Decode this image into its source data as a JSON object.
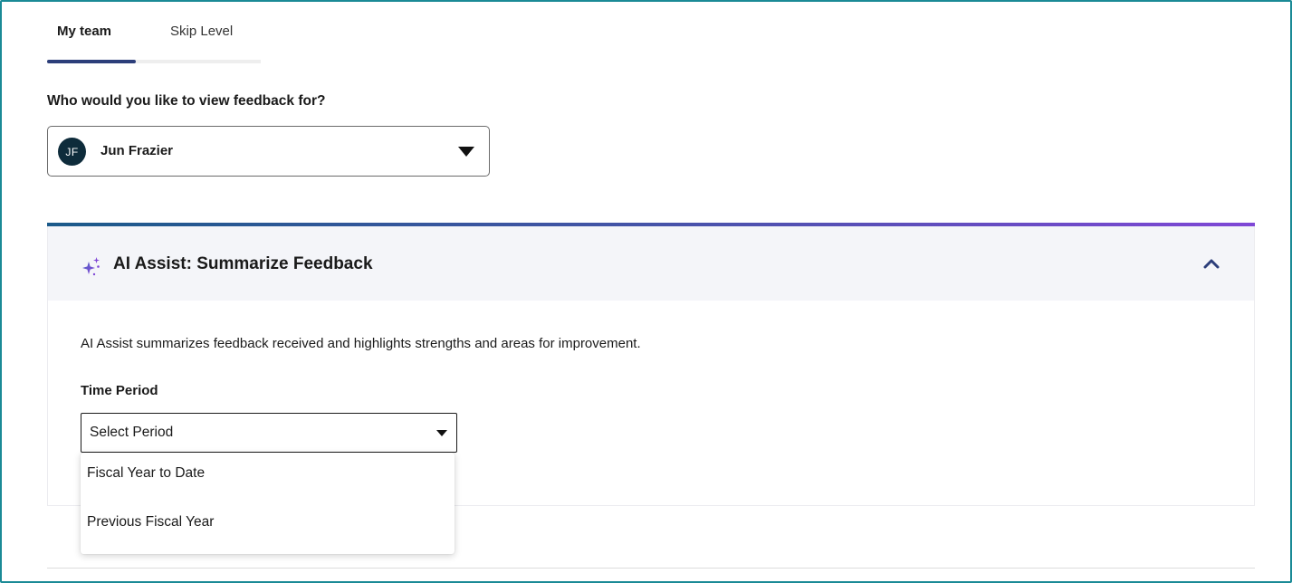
{
  "tabs": [
    {
      "label": "My team",
      "active": true
    },
    {
      "label": "Skip Level",
      "active": false
    }
  ],
  "question": "Who would you like to view feedback for?",
  "person_select": {
    "initials": "JF",
    "name": "Jun Frazier",
    "avatar_color": "#0e2c3b"
  },
  "ai_panel": {
    "title": "AI Assist: Summarize Feedback",
    "description": "AI Assist summarizes feedback received and highlights strengths and areas for improvement.",
    "time_period_label": "Time Period",
    "period_select": {
      "value": "Select Period",
      "options": [
        "Fiscal Year to Date",
        "Previous Fiscal Year"
      ]
    },
    "accent_colors": [
      "#1b5a8a",
      "#7f47d6"
    ],
    "icons": {
      "title": "sparkle-icon",
      "collapse": "chevron-up-icon"
    }
  },
  "colors": {
    "frame_border": "#1a8a96",
    "tab_indicator": "#2c3e7a",
    "header_bg": "#f4f5f9"
  }
}
